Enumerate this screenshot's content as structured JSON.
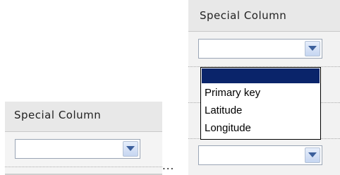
{
  "left_panel": {
    "header": "Special Column",
    "select_value": ""
  },
  "ellipsis": "...",
  "right_panel": {
    "header": "Special Column",
    "select_value": "",
    "dropdown": {
      "options": [
        "",
        "Primary key",
        "Latitude",
        "Longitude"
      ],
      "highlighted_index": 0
    }
  },
  "colors": {
    "highlight": "#0a246a",
    "arrow": "#3b5f9c",
    "header_bg": "#e8e8e8"
  }
}
